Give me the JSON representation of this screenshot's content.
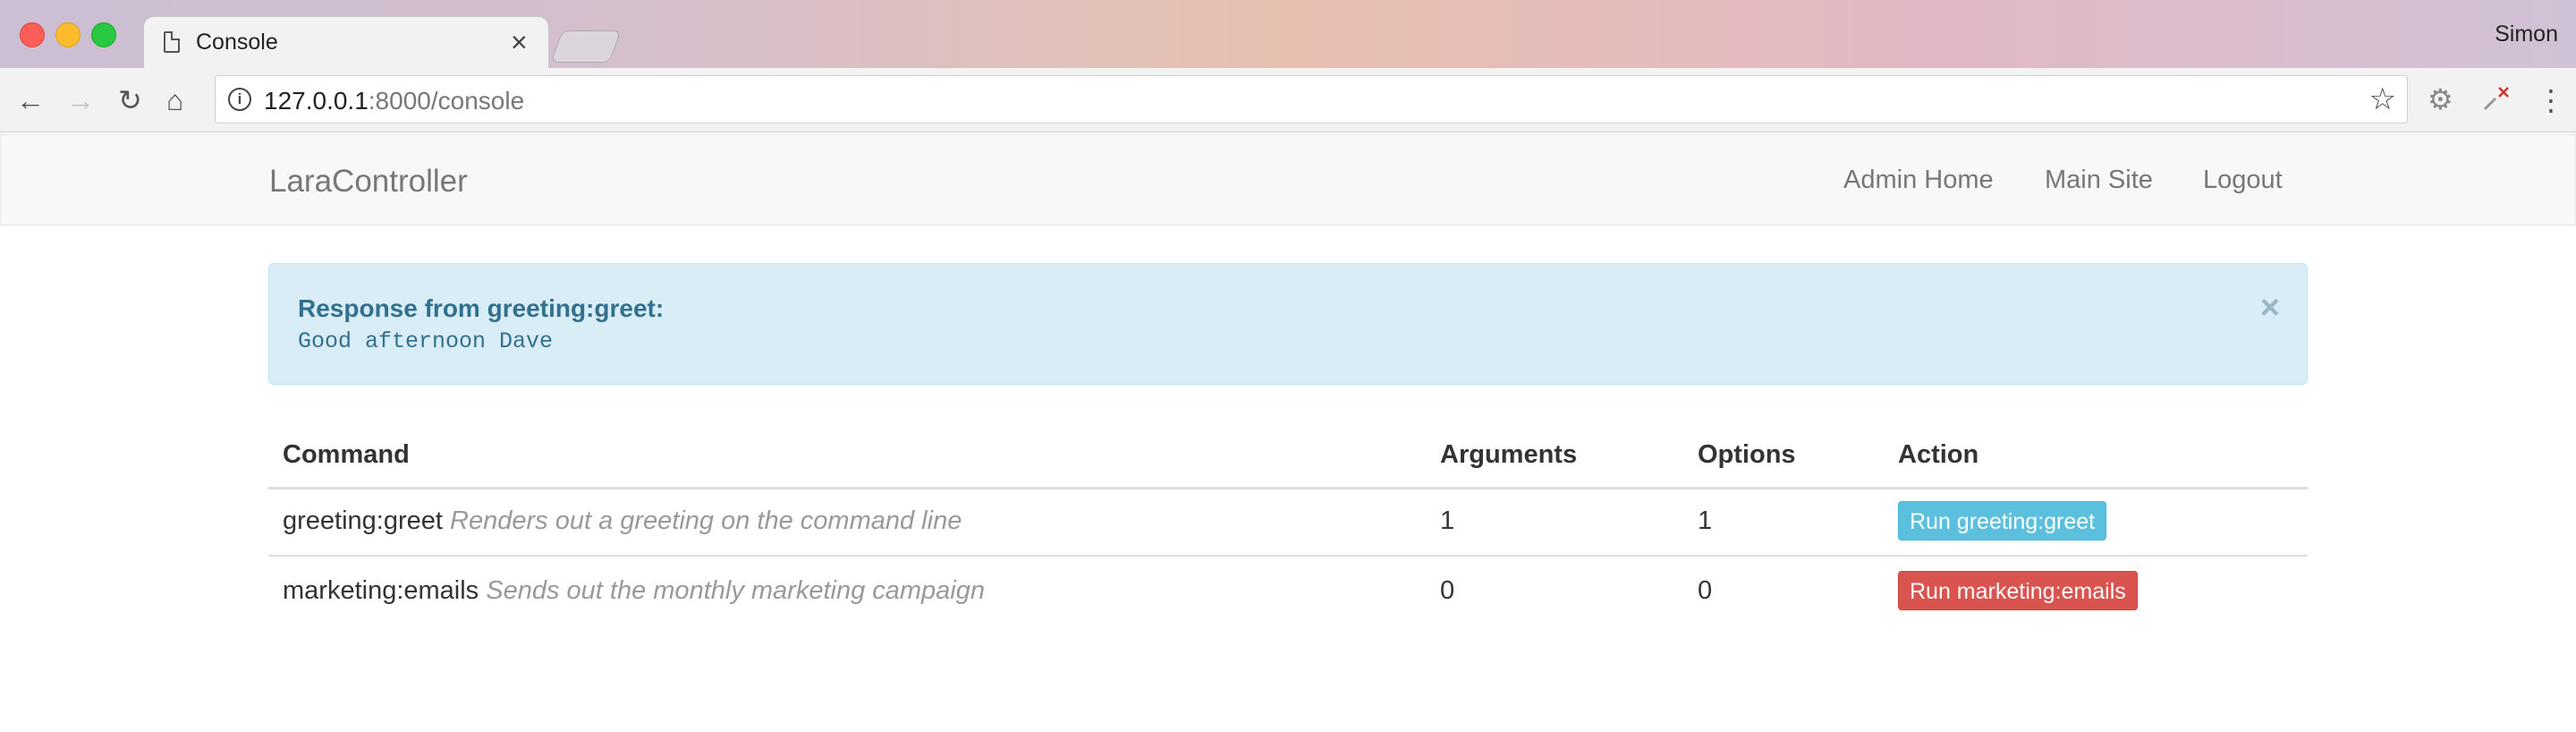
{
  "browser": {
    "tab_title": "Console",
    "profile_name": "Simon",
    "url_host": "127.0.0.1",
    "url_rest": ":8000/console",
    "icons": {
      "back": "back-arrow-icon",
      "forward": "forward-arrow-icon",
      "reload": "reload-icon",
      "home": "home-icon",
      "info": "info-icon",
      "bookmark": "star-icon",
      "menu": "kebab-menu-icon"
    }
  },
  "navbar": {
    "brand": "LaraController",
    "links": [
      "Admin Home",
      "Main Site",
      "Logout"
    ]
  },
  "alert": {
    "title": "Response from greeting:greet:",
    "message": "Good afternoon Dave",
    "close": "×"
  },
  "table": {
    "headers": [
      "Command",
      "Arguments",
      "Options",
      "Action"
    ],
    "rows": [
      {
        "command": "greeting:greet",
        "description": "Renders out a greeting on the command line",
        "arguments": "1",
        "options": "1",
        "action_label": "Run greeting:greet",
        "action_color": "#5bc0de"
      },
      {
        "command": "marketing:emails",
        "description": "Sends out the monthly marketing campaign",
        "arguments": "0",
        "options": "0",
        "action_label": "Run marketing:emails",
        "action_color": "#d9534f"
      }
    ]
  },
  "colors": {
    "alert_bg": "#d9edf7",
    "alert_text": "#31708f",
    "navbar_bg": "#f8f8f8"
  }
}
